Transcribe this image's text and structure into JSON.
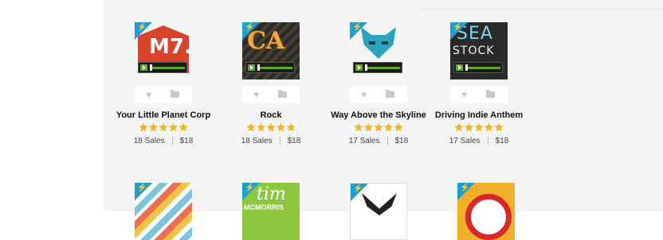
{
  "products": [
    {
      "title": "Your Little Planet Corp",
      "sales": "18 Sales",
      "price": "$18",
      "art_icon": "m7-logo",
      "art_text": "M7."
    },
    {
      "title": "Rock",
      "sales": "18 Sales",
      "price": "$18",
      "art_icon": "rock-letters",
      "art_text": "CA"
    },
    {
      "title": "Way Above the Skyline",
      "sales": "17 Sales",
      "price": "$18",
      "art_icon": "fox-logo"
    },
    {
      "title": "Driving Indie Anthem",
      "sales": "17 Sales",
      "price": "$18",
      "art_icon": "seastock-logo",
      "art_text": "SEA",
      "art_text2": "STOCK"
    },
    {
      "art_icon": "stripes-art"
    },
    {
      "art_icon": "tim-logo",
      "art_text": "tim",
      "art_text2": "MCMORRIS"
    },
    {
      "art_icon": "bird-emblem"
    },
    {
      "art_icon": "ring-logo"
    }
  ],
  "rating_stars": 5,
  "badge_icon": "lightning-icon",
  "colors": {
    "badge": "#1e9fd4",
    "stars": "#f5b50c",
    "player_accent": "#5fa82b"
  }
}
